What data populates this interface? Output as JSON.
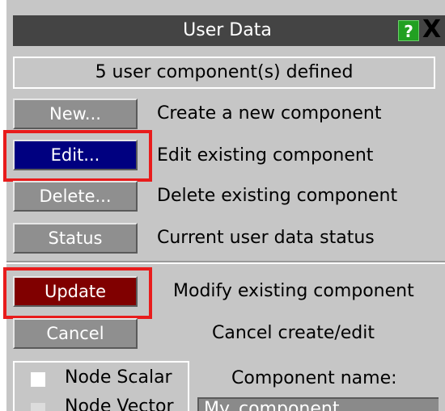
{
  "window": {
    "title": "User Data",
    "help_label": "?",
    "close_label": "X"
  },
  "status": {
    "component_count_text": "5 user component(s) defined"
  },
  "actions": [
    {
      "button": "New...",
      "description": "Create a new component"
    },
    {
      "button": "Edit...",
      "description": "Edit existing component"
    },
    {
      "button": "Delete...",
      "description": "Delete existing component"
    },
    {
      "button": "Status",
      "description": "Current user data status"
    }
  ],
  "edit_actions": [
    {
      "button": "Update",
      "description": "Modify existing component"
    },
    {
      "button": "Cancel",
      "description": "Cancel create/edit"
    }
  ],
  "component_types": [
    {
      "label": "Node Scalar",
      "checked": false
    },
    {
      "label": "Node Vector",
      "checked": false
    }
  ],
  "component_name": {
    "label": "Component name:",
    "value": "My_component"
  },
  "colors": {
    "edit_button_bg": "#000080",
    "update_button_bg": "#800000",
    "highlight_box": "#e81c1c",
    "help_icon_bg": "#22a022"
  }
}
